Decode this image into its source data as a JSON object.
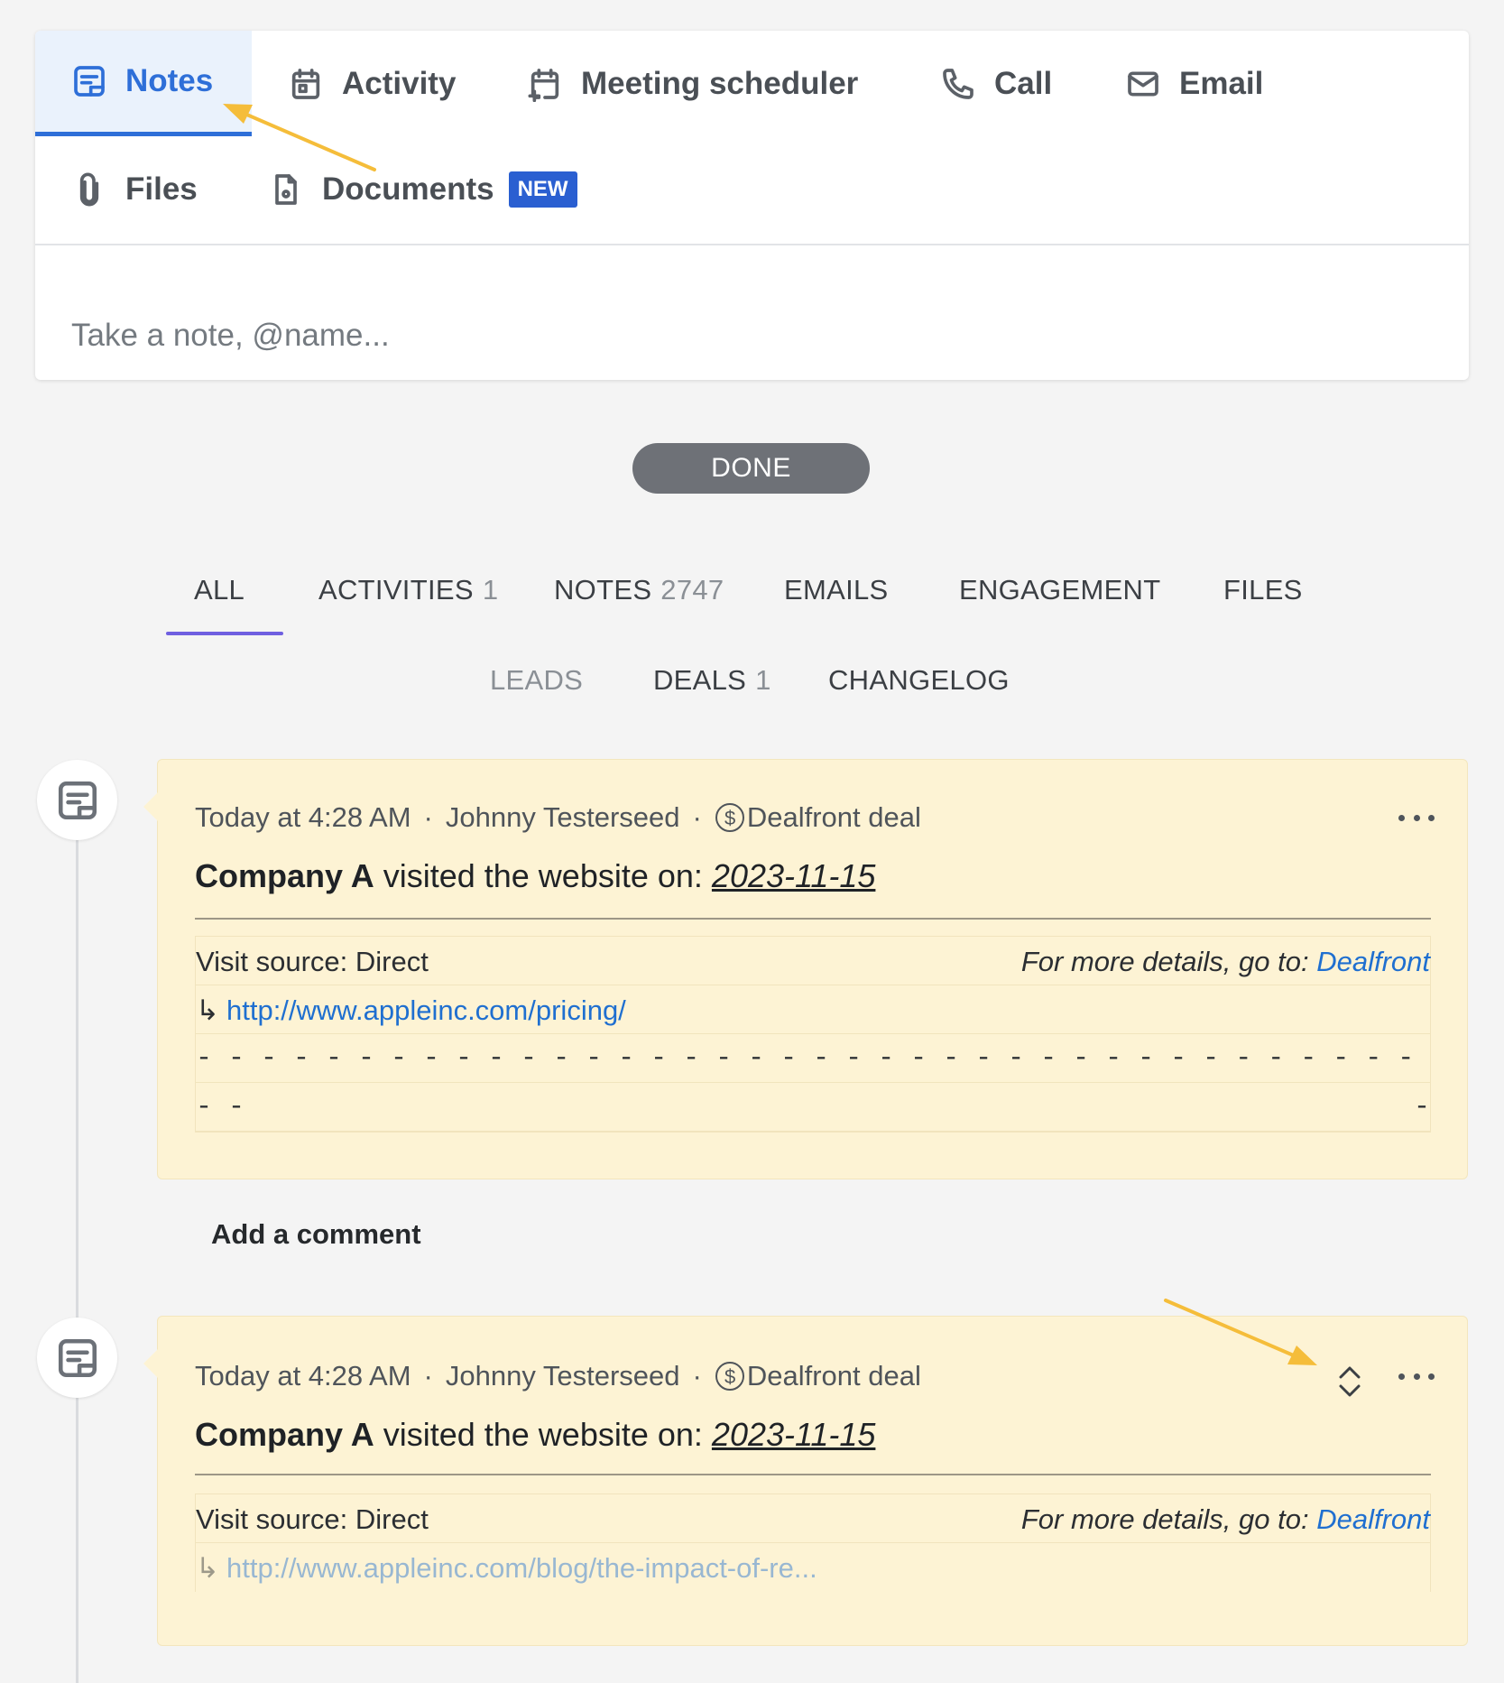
{
  "composer": {
    "tabs_row1": [
      {
        "label": "Notes",
        "icon": "note-icon",
        "active": true
      },
      {
        "label": "Activity",
        "icon": "calendar-icon"
      },
      {
        "label": "Meeting scheduler",
        "icon": "meeting-scheduler-icon"
      },
      {
        "label": "Call",
        "icon": "phone-icon"
      },
      {
        "label": "Email",
        "icon": "mail-icon"
      }
    ],
    "tabs_row2": [
      {
        "label": "Files",
        "icon": "paperclip-icon"
      },
      {
        "label": "Documents",
        "icon": "document-icon",
        "badge": "NEW"
      }
    ],
    "note_placeholder": "Take a note, @name..."
  },
  "done_label": "DONE",
  "filters": {
    "row1": [
      {
        "label": "ALL",
        "count": ""
      },
      {
        "label": "ACTIVITIES",
        "count": "1"
      },
      {
        "label": "NOTES",
        "count": "2747"
      },
      {
        "label": "EMAILS",
        "count": ""
      },
      {
        "label": "ENGAGEMENT",
        "count": ""
      },
      {
        "label": "FILES",
        "count": ""
      }
    ],
    "row2": [
      {
        "label": "LEADS",
        "count": ""
      },
      {
        "label": "DEALS",
        "count": "1"
      },
      {
        "label": "CHANGELOG",
        "count": ""
      }
    ],
    "active": "ALL"
  },
  "feed": [
    {
      "time": "Today at 4:28 AM",
      "author": "Johnny Testerseed",
      "deal": "Dealfront deal",
      "company": "Company A",
      "headline_text": "visited the website on:",
      "date": "2023-11-15",
      "visit_source": "Visit source: Direct",
      "details_prefix": "For more details, go to:",
      "details_link": "Dealfront",
      "url": "http://www.appleinc.com/pricing/",
      "dash_line_1": "- - - - - - - - - - - - - - - - - - - - - - - - - - - - - - - - - - - - - - - - -  - - - - - - - - - - - - - - -",
      "dash_line_2_left": "- -",
      "dash_line_2_right": "-"
    },
    {
      "time": "Today at 4:28 AM",
      "author": "Johnny Testerseed",
      "deal": "Dealfront deal",
      "company": "Company A",
      "headline_text": "visited the website on:",
      "date": "2023-11-15",
      "visit_source": "Visit source: Direct",
      "details_prefix": "For more details, go to:",
      "details_link": "Dealfront",
      "url": "http://www.appleinc.com/blog/the-impact-of-re..."
    }
  ],
  "add_comment": "Add a comment",
  "meta_separator": "·",
  "url_arrow": "↳",
  "colors": {
    "accent": "#2e6fd8",
    "filter_underline": "#6f5fe0",
    "card_bg": "#fdf3d4",
    "badge_bg": "#2a5fd1",
    "annotation_arrow": "#f5bd3a"
  }
}
